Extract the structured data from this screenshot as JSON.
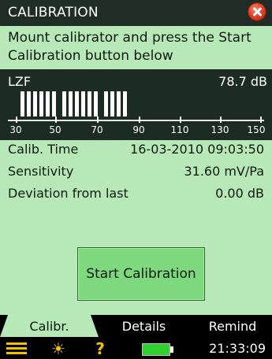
{
  "header": {
    "title": "CALIBRATION"
  },
  "instruction": "Mount calibrator and press the Start Calibration button below",
  "meter": {
    "label": "LZF",
    "value": "78.7 dB",
    "scale_ticks": [
      "30",
      "50",
      "70",
      "90",
      "110",
      "130",
      "150"
    ]
  },
  "info": {
    "calib_time_label": "Calib. Time",
    "calib_time_value": "16-03-2010 09:03:50",
    "sensitivity_label": "Sensitivity",
    "sensitivity_value": "31.60 mV/Pa",
    "deviation_label": "Deviation from last",
    "deviation_value": "0.00 dB"
  },
  "start_button": "Start Calibration",
  "tabs": [
    {
      "label": "Calibr.",
      "active": true
    },
    {
      "label": "Details",
      "active": false
    },
    {
      "label": "Remind",
      "active": false
    }
  ],
  "status": {
    "time": "21:33:09",
    "icons": [
      "menu-icon",
      "backlight-icon",
      "help-icon",
      "battery-icon"
    ]
  },
  "colors": {
    "panel": "#b8e8b8",
    "dark": "#1c2b23",
    "button": "#7ed87e",
    "accent": "#f2c200",
    "close": "#e0442a",
    "battery": "#2ed12e"
  }
}
